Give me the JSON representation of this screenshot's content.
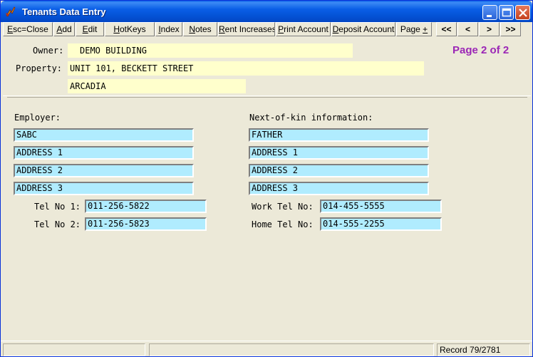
{
  "window": {
    "title": "Tenants Data Entry",
    "titlebar_color": "#0a5ee6"
  },
  "toolbar": {
    "buttons": [
      {
        "prefix": "",
        "key": "E",
        "rest": "sc=Close"
      },
      {
        "prefix": "",
        "key": "A",
        "rest": "dd"
      },
      {
        "prefix": "",
        "key": "E",
        "rest": "dit"
      },
      {
        "prefix": "",
        "key": "H",
        "rest": "otKeys"
      },
      {
        "prefix": "",
        "key": "I",
        "rest": "ndex"
      },
      {
        "prefix": "",
        "key": "N",
        "rest": "otes"
      },
      {
        "prefix": "",
        "key": "R",
        "rest": "ent Increases"
      },
      {
        "prefix": "",
        "key": "P",
        "rest": "rint Account"
      },
      {
        "prefix": "",
        "key": "D",
        "rest": "eposit Account"
      },
      {
        "prefix": "Page ",
        "key": "+",
        "rest": ""
      },
      {
        "prefix": "",
        "key": "",
        "rest": "<<"
      },
      {
        "prefix": "",
        "key": "",
        "rest": "<"
      },
      {
        "prefix": "",
        "key": "",
        "rest": ">"
      },
      {
        "prefix": "",
        "key": "",
        "rest": ">>"
      }
    ]
  },
  "header": {
    "owner_label": "Owner:",
    "owner_value": "DEMO BUILDING",
    "property_label": "Property:",
    "property_line1": "UNIT 101, BECKETT STREET",
    "property_line2": "ARCADIA",
    "page_indicator": "Page 2 of 2",
    "page_indicator_color": "#9b26b6"
  },
  "employer": {
    "label": "Employer:",
    "name": "SABC",
    "address1": "ADDRESS 1",
    "address2": "ADDRESS 2",
    "address3": "ADDRESS 3",
    "tel1_label": "Tel No 1:",
    "tel1": "011-256-5822",
    "tel2_label": "Tel No 2:",
    "tel2": "011-256-5823"
  },
  "next_of_kin": {
    "label": "Next-of-kin information:",
    "name": "FATHER",
    "address1": "ADDRESS 1",
    "address2": "ADDRESS 2",
    "address3": "ADDRESS 3",
    "work_tel_label": "Work Tel No:",
    "work_tel": "014-455-5555",
    "home_tel_label": "Home Tel No:",
    "home_tel": "014-555-2255"
  },
  "statusbar": {
    "record": "Record 79/2781"
  },
  "colors": {
    "field_bg": "#b0ecfe",
    "header_field_bg": "#ffffcc"
  }
}
